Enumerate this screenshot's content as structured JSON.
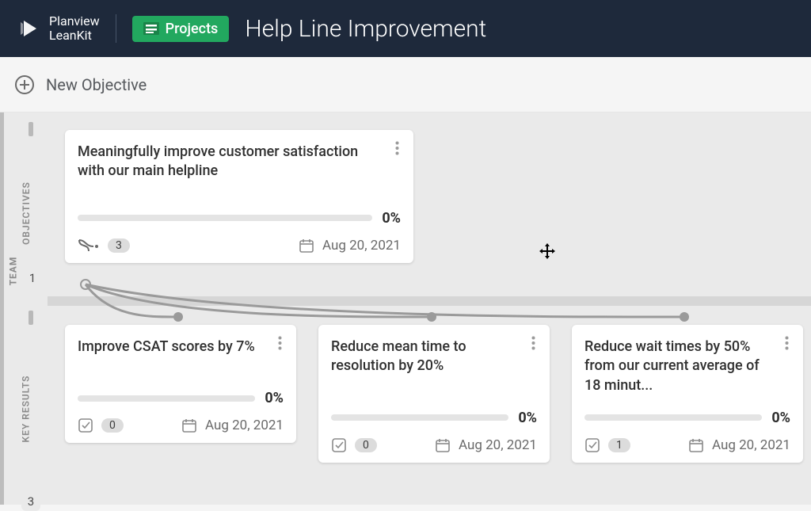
{
  "header": {
    "brand_line1": "Planview",
    "brand_line2": "LeanKit",
    "badge_label": "Projects",
    "title": "Help Line Improvement"
  },
  "toolbar": {
    "new_objective_label": "New Objective"
  },
  "rails": {
    "objectives": "OBJECTIVES",
    "key_results": "KEY RESULTS",
    "team": "TEAM",
    "team_count": "1",
    "kr_count": "3"
  },
  "objective_card": {
    "title": "Meaningfully improve customer satisfaction with our main helpline",
    "percent": "0%",
    "children_count": "3",
    "due_date": "Aug 20, 2021"
  },
  "kr_cards": [
    {
      "title": "Improve CSAT scores by 7%",
      "percent": "0%",
      "tasks": "0",
      "due_date": "Aug 20, 2021"
    },
    {
      "title": "Reduce mean time to resolution by 20%",
      "percent": "0%",
      "tasks": "0",
      "due_date": "Aug 20, 2021"
    },
    {
      "title": "Reduce wait times by 50% from our current average of 18 minut...",
      "percent": "0%",
      "tasks": "1",
      "due_date": "Aug 20, 2021"
    }
  ]
}
